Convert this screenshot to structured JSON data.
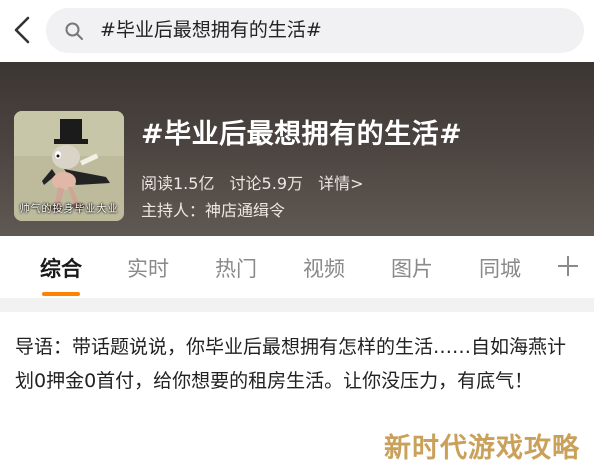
{
  "search": {
    "query": "#毕业后最想拥有的生活#"
  },
  "topic": {
    "title": "#毕业后最想拥有的生活#",
    "reads": "阅读1.5亿",
    "discussions": "讨论5.9万",
    "details_link": "详情>",
    "host_label": "主持人：",
    "host_name": "神店通缉令",
    "cover_caption": "帅气的投身毕业大业"
  },
  "tabs": [
    {
      "label": "综合",
      "active": true
    },
    {
      "label": "实时",
      "active": false
    },
    {
      "label": "热门",
      "active": false
    },
    {
      "label": "视频",
      "active": false
    },
    {
      "label": "图片",
      "active": false
    },
    {
      "label": "同城",
      "active": false
    }
  ],
  "intro": {
    "text": "导语：带话题说说，你毕业后最想拥有怎样的生活……自如海燕计划0押金0首付，给你想要的租房生活。让你没压力，有底气！"
  },
  "watermark": {
    "text": "新时代游戏攻略"
  },
  "icons": {
    "back": "back-arrow-icon",
    "search": "search-icon",
    "add": "plus-icon"
  },
  "colors": {
    "accent": "#ff8200",
    "banner": "#4a433f",
    "search_bg": "#f1f1f3"
  }
}
